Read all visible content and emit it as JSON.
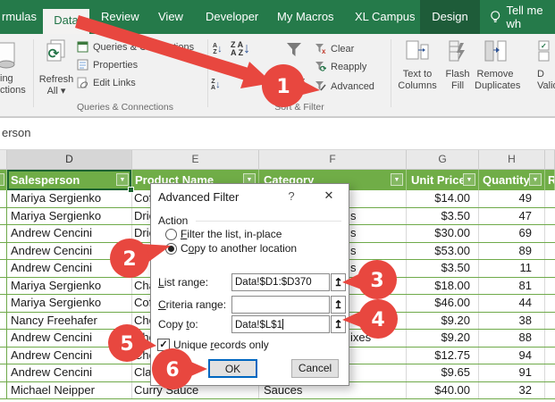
{
  "tab_bar": {
    "tabs": [
      {
        "label": "rmulas"
      },
      {
        "label": "Data"
      },
      {
        "label": "Review"
      },
      {
        "label": "View"
      },
      {
        "label": "Developer"
      },
      {
        "label": "My Macros"
      },
      {
        "label": "XL Campus"
      },
      {
        "label": "Design"
      },
      {
        "label": "Tell me wh"
      }
    ]
  },
  "ribbon": {
    "partial_left": {
      "line1": "ing",
      "line2": "ctions"
    },
    "refresh": {
      "line1": "Refresh",
      "line2": "All ▾"
    },
    "queries_button": "Queries & Connections",
    "properties_button": "Properties",
    "edit_links_button": "Edit Links",
    "filter_button": "Filter",
    "clear_button": "Clear",
    "reapply_button": "Reapply",
    "advanced_button": "Advanced",
    "text_to_columns": {
      "line1": "Text to",
      "line2": "Columns"
    },
    "flash_fill": {
      "line1": "Flash",
      "line2": "Fill"
    },
    "remove_duplicates": {
      "line1": "Remove",
      "line2": "Duplicates"
    },
    "data_validation": {
      "line1": "D",
      "line2": "Valid."
    },
    "group_queries": "Queries & Connections",
    "group_sort_filter": "Sort & Filter"
  },
  "formula_bar": {
    "text": "erson"
  },
  "sheet": {
    "column_letters": [
      "D",
      "E",
      "F",
      "G",
      "H"
    ],
    "headers": {
      "d": "Salesperson",
      "e": "Product Name",
      "f": "Category",
      "g": "Unit Price",
      "h": "Quantity",
      "i_partial": "R"
    },
    "rows": [
      {
        "sp": "Mariya Sergienko",
        "prod": "Coff",
        "cat": "",
        "price": "$14.00",
        "qty": "49"
      },
      {
        "sp": "Mariya Sergienko",
        "prod": "Drie",
        "cat": "s",
        "price": "$3.50",
        "qty": "47"
      },
      {
        "sp": "Andrew Cencini",
        "prod": "Drie",
        "cat": "s",
        "price": "$30.00",
        "qty": "69"
      },
      {
        "sp": "Andrew Cencini",
        "prod": "",
        "cat": "s",
        "price": "$53.00",
        "qty": "89"
      },
      {
        "sp": "Andrew Cencini",
        "prod": "ie",
        "cat": "s",
        "price": "$3.50",
        "qty": "11"
      },
      {
        "sp": "Mariya Sergienko",
        "prod": "Chai",
        "cat": "",
        "price": "$18.00",
        "qty": "81"
      },
      {
        "sp": "Mariya Sergienko",
        "prod": "Coff",
        "cat": "",
        "price": "$46.00",
        "qty": "44"
      },
      {
        "sp": "Nancy Freehafer",
        "prod": "Choc",
        "cat": "",
        "price": "$9.20",
        "qty": "38"
      },
      {
        "sp": "Andrew Cencini",
        "prod": "Cho",
        "cat": "ixes",
        "price": "$9.20",
        "qty": "88"
      },
      {
        "sp": "Andrew Cencini",
        "prod": "Cho",
        "cat": "",
        "price": "$12.75",
        "qty": "94"
      },
      {
        "sp": "Andrew Cencini",
        "prod": "Clam",
        "cat": "",
        "price": "$9.65",
        "qty": "91"
      },
      {
        "sp": "Michael Neipper",
        "prod": "Curry Sauce",
        "cat": "Sauces",
        "price": "$40.00",
        "qty": "32"
      }
    ]
  },
  "dialog": {
    "title": "Advanced Filter",
    "help_label": "?",
    "close_label": "✕",
    "action_label": "Action",
    "radio_filter": {
      "pre": "",
      "u": "F",
      "post": "ilter the list, in-place"
    },
    "radio_copy": {
      "pre": "C",
      "u": "o",
      "post": "py to another location"
    },
    "list_range": {
      "pre": "",
      "u": "L",
      "post": "ist range:",
      "value": "Data!$D1:$D370"
    },
    "criteria_range": {
      "pre": "",
      "u": "C",
      "post": "riteria range:",
      "value": ""
    },
    "copy_to": {
      "pre": "Copy ",
      "u": "t",
      "post": "o:",
      "value": "Data!$L$1"
    },
    "unique": {
      "pre": "Unique ",
      "u": "r",
      "post": "ecords only"
    },
    "ok_label": "OK",
    "cancel_label": "Cancel"
  },
  "annotations": {
    "steps": [
      "1",
      "2",
      "3",
      "4",
      "5",
      "6"
    ],
    "color": "#e8473f"
  },
  "icons": {
    "dropdown": "▼",
    "range_collapse": "↥",
    "check": "✓",
    "az_arrow": "↓",
    "refresh": "⟳",
    "clear_x": "✕"
  },
  "colors": {
    "excel_green": "#217346",
    "tab_bar_green": "#257a4a",
    "table_header_green": "#70ad47",
    "annotation_red": "#e8473f",
    "focus_blue": "#0067c0",
    "selection_green": "#1d6330"
  }
}
